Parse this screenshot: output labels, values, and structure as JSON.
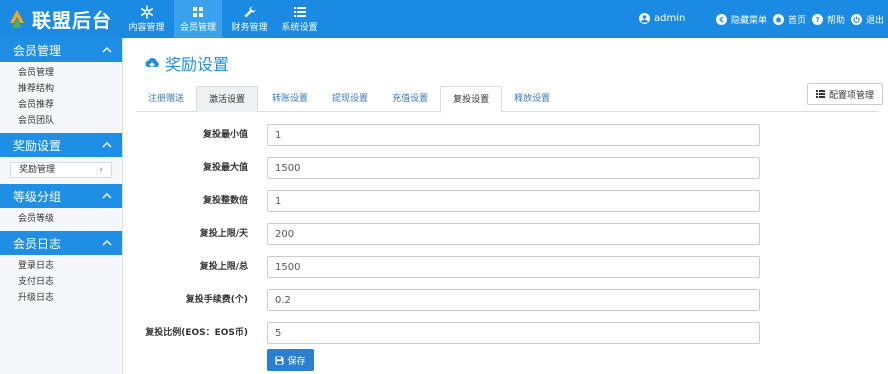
{
  "app": {
    "title": "联盟后台"
  },
  "topnav": [
    {
      "label": "内容管理",
      "icon": "asterisk-icon"
    },
    {
      "label": "会员管理",
      "icon": "grid-icon"
    },
    {
      "label": "财务管理",
      "icon": "wrench-icon"
    },
    {
      "label": "系统设置",
      "icon": "list-icon"
    }
  ],
  "user": {
    "name": "admin"
  },
  "toplinks": {
    "hide_menu": "隐藏菜单",
    "home": "首页",
    "help": "帮助",
    "logout": "退出"
  },
  "sidebar": {
    "sections": [
      {
        "title": "会员管理",
        "items": [
          "会员管理",
          "推荐结构",
          "会员推荐",
          "会员团队"
        ]
      },
      {
        "title": "奖励设置",
        "items": [
          "奖励管理"
        ]
      },
      {
        "title": "等级分组",
        "items": [
          "会员等级"
        ]
      },
      {
        "title": "会员日志",
        "items": [
          "登录日志",
          "支付日志",
          "升级日志"
        ]
      }
    ]
  },
  "page": {
    "title": "奖励设置",
    "config_button": "配置项管理"
  },
  "tabs": [
    "注册赠送",
    "激活设置",
    "转账设置",
    "提现设置",
    "充值设置",
    "复投设置",
    "释放设置"
  ],
  "form": {
    "fields": [
      {
        "label": "复投最小值",
        "value": "1"
      },
      {
        "label": "复投最大值",
        "value": "1500"
      },
      {
        "label": "复投整数倍",
        "value": "1"
      },
      {
        "label": "复投上限/天",
        "value": "200"
      },
      {
        "label": "复投上限/总",
        "value": "1500"
      },
      {
        "label": "复投手续费(个)",
        "value": "0.2"
      },
      {
        "label": "复投比例(EOS：EOS币)",
        "value": "5"
      }
    ],
    "save_label": "保存"
  },
  "colors": {
    "primary": "#1a8ae3",
    "sidebar_head": "#1f8fe6",
    "save": "#2b7fd0"
  }
}
